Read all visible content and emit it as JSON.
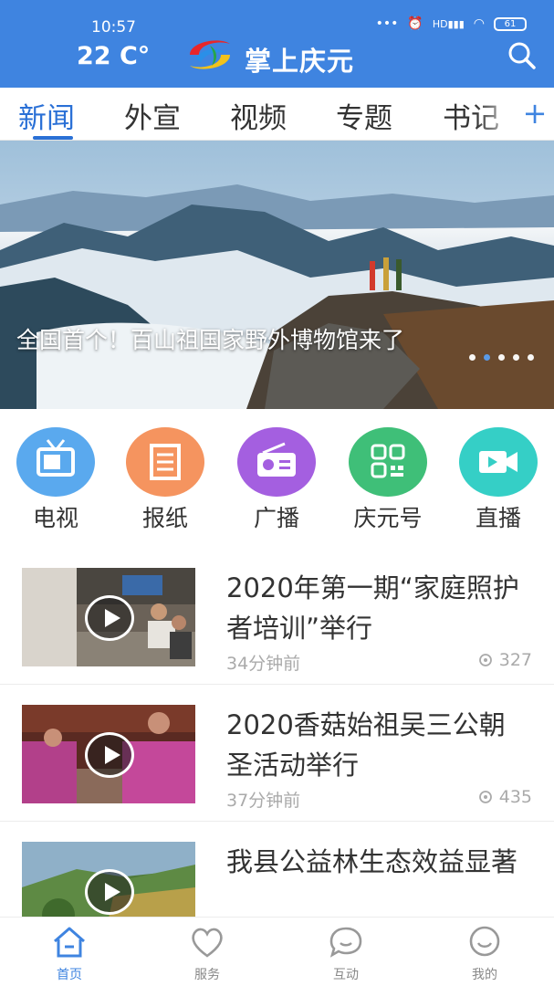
{
  "status_bar": {
    "time": "10:57",
    "hd": "HD",
    "battery": "61"
  },
  "header": {
    "temperature": "22 C°",
    "title": "掌上庆元",
    "search_icon": "search-icon"
  },
  "tabs": [
    {
      "label": "新闻",
      "active": true
    },
    {
      "label": "外宣",
      "active": false
    },
    {
      "label": "视频",
      "active": false
    },
    {
      "label": "专题",
      "active": false
    },
    {
      "label": "书记",
      "active": false
    }
  ],
  "tab_add": "+",
  "banner": {
    "title": "全国首个！百山祖国家野外博物馆来了",
    "slide_count": 5,
    "active_slide": 1
  },
  "quick_entries": [
    {
      "label": "电视",
      "icon": "tv-icon",
      "color": "#5aa9ee"
    },
    {
      "label": "报纸",
      "icon": "newspaper-icon",
      "color": "#f5945f"
    },
    {
      "label": "广播",
      "icon": "radio-icon",
      "color": "#a45fe0"
    },
    {
      "label": "庆元号",
      "icon": "qrcode-icon",
      "color": "#3fbf78"
    },
    {
      "label": "直播",
      "icon": "video-camera-icon",
      "color": "#35cfc6"
    }
  ],
  "news": [
    {
      "title": "2020年第一期“家庭照护者培训”举行",
      "time": "34分钟前",
      "views": "327"
    },
    {
      "title": "2020香菇始祖吴三公朝圣活动举行",
      "time": "37分钟前",
      "views": "435"
    },
    {
      "title": "我县公益林生态效益显著",
      "time": "",
      "views": ""
    }
  ],
  "bottom_nav": [
    {
      "label": "首页",
      "icon": "home-icon",
      "active": true
    },
    {
      "label": "服务",
      "icon": "heart-icon",
      "active": false
    },
    {
      "label": "互动",
      "icon": "chat-icon",
      "active": false
    },
    {
      "label": "我的",
      "icon": "smile-icon",
      "active": false
    }
  ],
  "colors": {
    "brand": "#3f84e0",
    "tab_active": "#2a70d6"
  }
}
